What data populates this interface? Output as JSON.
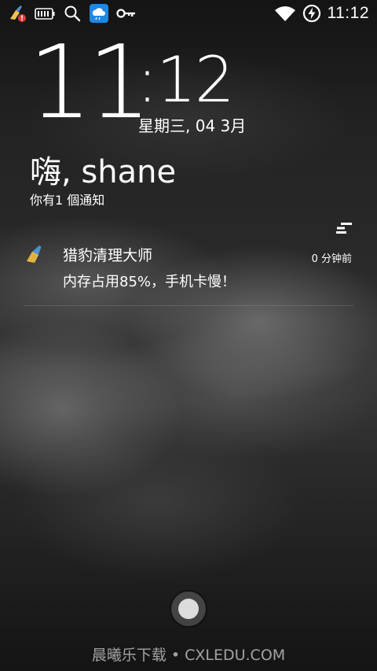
{
  "status_bar": {
    "time": "11:12",
    "icons_left": [
      "cleaner-alert-icon",
      "battery-level-icon",
      "search-icon",
      "weather-cloud-icon",
      "key-icon"
    ],
    "icons_right": [
      "wifi-icon",
      "battery-charging-icon"
    ],
    "accent": "#1e88e5",
    "alert": "#e53935"
  },
  "clock": {
    "hour": "11",
    "minute": ":12",
    "date": "星期三, 04 3月"
  },
  "greeting": "嗨, shane",
  "notification_count": "你有1 個通知",
  "notification": {
    "app_name": "猎豹清理大师",
    "time": "0 分钟前",
    "message": "内存占用85%，手机卡慢！",
    "icon": "broom-icon"
  },
  "watermark": "晨曦乐下载 • CXLEDU.COM"
}
